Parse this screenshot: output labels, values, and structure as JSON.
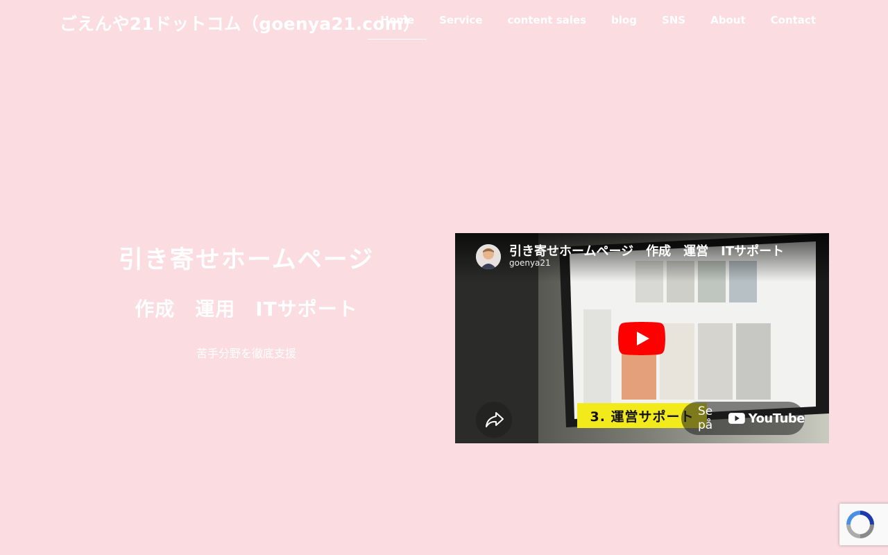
{
  "header": {
    "site_title": "ごえんや21ドットコム（goenya21.com）",
    "nav": [
      {
        "label": "Home",
        "active": true
      },
      {
        "label": "Service"
      },
      {
        "label": "content sales"
      },
      {
        "label": "blog"
      },
      {
        "label": "SNS"
      },
      {
        "label": "About"
      },
      {
        "label": "Contact"
      }
    ]
  },
  "hero": {
    "title": "引き寄せホームページ",
    "subtitle": "作成　運用　ITサポート",
    "tagline": "苦手分野を徹底支援"
  },
  "video": {
    "title": "引き寄せホームページ　作成　運営　ITサポート",
    "channel": "goenya21",
    "banner_text": "3. 運営サポート",
    "watch_label": "Se på",
    "youtube_label": "YouTube",
    "icons": [
      "channel-avatar",
      "play-icon",
      "share-icon",
      "youtube-logo-icon"
    ]
  },
  "colors": {
    "background": "#fadce1",
    "text": "#ffffff",
    "youtube_red": "#ff0000",
    "banner_yellow": "#f2ea1b"
  }
}
